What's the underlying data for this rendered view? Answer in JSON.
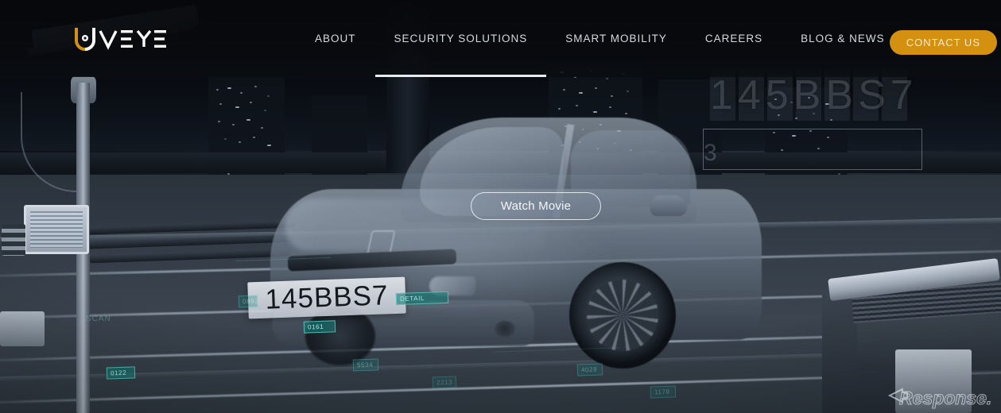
{
  "site": {
    "brand_name": "UVEYE",
    "accent_color": "#d4900f",
    "header_bg": "#06080b"
  },
  "header": {
    "logo_name": "uveye-logo",
    "nav": [
      {
        "label": "ABOUT",
        "name": "nav-about",
        "active": false
      },
      {
        "label": "SECURITY SOLUTIONS",
        "name": "nav-security-solutions",
        "active": true
      },
      {
        "label": "SMART MOBILITY",
        "name": "nav-smart-mobility",
        "active": false
      },
      {
        "label": "CAREERS",
        "name": "nav-careers",
        "active": false
      },
      {
        "label": "BLOG & NEWS",
        "name": "nav-blog-news",
        "active": false
      }
    ],
    "cta_label": "CONTACT US"
  },
  "hero": {
    "watch_button_label": "Watch Movie",
    "license_plate": "145BBS7",
    "hud_plate_readout": "145BBS7",
    "hud_digit": "3",
    "hud_tags": [
      {
        "label": "DETAIL",
        "name": "hud-tag-detail"
      },
      {
        "label": "0161",
        "name": "hud-tag-0161"
      },
      {
        "label": "0122",
        "name": "hud-tag-0122"
      },
      {
        "label": "5534",
        "name": "hud-tag-5534"
      },
      {
        "label": "4028",
        "name": "hud-tag-4028"
      },
      {
        "label": "1178",
        "name": "hud-tag-1178"
      },
      {
        "label": "2213",
        "name": "hud-tag-2213"
      },
      {
        "label": "0893",
        "name": "hud-tag-0893"
      }
    ],
    "hud_scan_text": "SCAN"
  },
  "watermark": {
    "label": "Response."
  }
}
